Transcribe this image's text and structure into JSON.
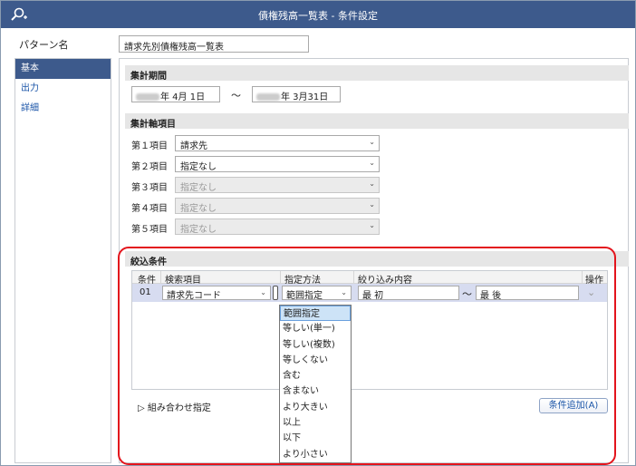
{
  "window": {
    "title": "債権残高一覧表 - 条件設定",
    "icon": "search-plus-icon"
  },
  "pattern": {
    "label": "パターン名",
    "value": "請求先別債権残高一覧表"
  },
  "sidebar": {
    "items": [
      {
        "label": "基本",
        "active": true
      },
      {
        "label": "出力"
      },
      {
        "label": "詳細"
      }
    ]
  },
  "period": {
    "section": "集計期間",
    "start_suffix": "年  4月  1日",
    "separator": "〜",
    "end_suffix": "年  3月31日"
  },
  "axis": {
    "section": "集計軸項目",
    "rows": [
      {
        "label": "第１項目",
        "value": "請求先",
        "enabled": true
      },
      {
        "label": "第２項目",
        "value": "指定なし",
        "enabled": true
      },
      {
        "label": "第３項目",
        "value": "指定なし",
        "enabled": false
      },
      {
        "label": "第４項目",
        "value": "指定なし",
        "enabled": false
      },
      {
        "label": "第５項目",
        "value": "指定なし",
        "enabled": false
      }
    ]
  },
  "filter": {
    "section": "絞込条件",
    "headers": {
      "cond": "条件",
      "field": "検索項目",
      "method": "指定方法",
      "content": "絞り込み内容",
      "op": "操作"
    },
    "row": {
      "num": "01",
      "field": "請求先コード",
      "method": "範囲指定",
      "from": "最 初",
      "tilde": "〜",
      "to": "最 後"
    },
    "options": [
      "範囲指定",
      "等しい(単一)",
      "等しい(複数)",
      "等しくない",
      "含む",
      "含まない",
      "より大きい",
      "以上",
      "以下",
      "より小さい"
    ],
    "combo_label": "組み合わせ指定",
    "add_button": "条件追加(A)"
  },
  "colors": {
    "titlebar": "#3d5a8c",
    "highlight": "#e3141c",
    "row_selected": "#d7dcf0"
  }
}
